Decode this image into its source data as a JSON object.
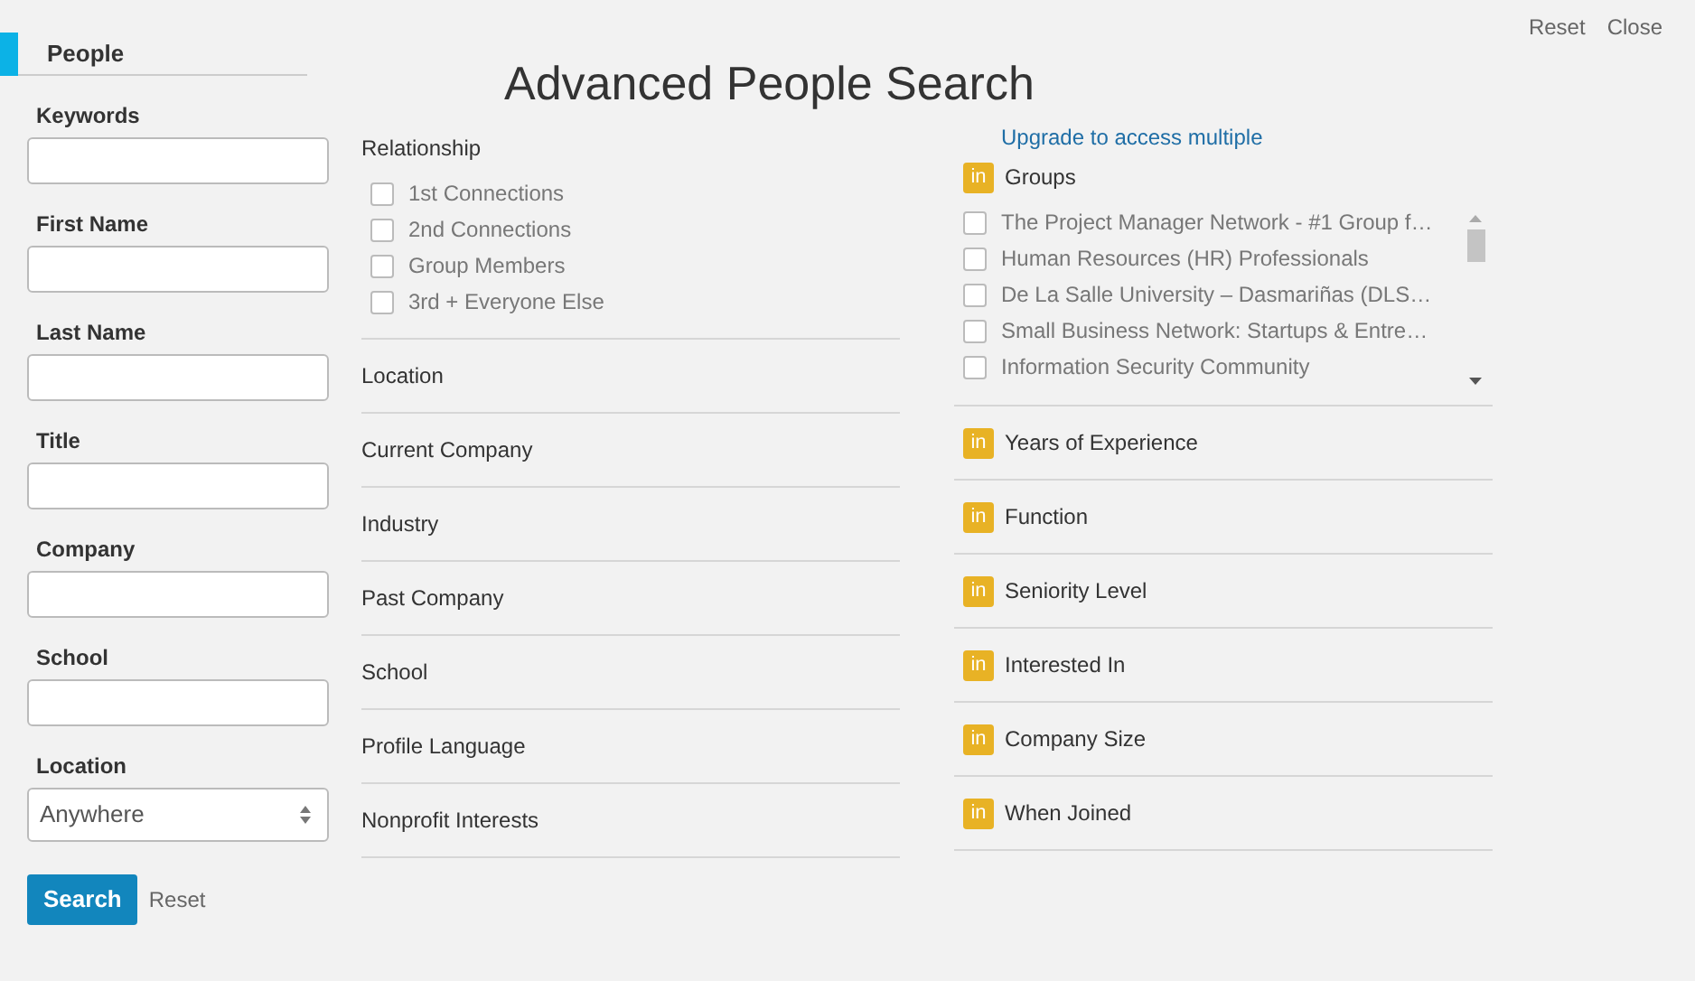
{
  "sidebar": {
    "tab": {
      "label": "People",
      "selected": true
    },
    "fields": [
      {
        "kind": "text",
        "label": "Keywords"
      },
      {
        "kind": "text",
        "label": "First Name"
      },
      {
        "kind": "text",
        "label": "Last Name"
      },
      {
        "kind": "text",
        "label": "Title"
      },
      {
        "kind": "text",
        "label": "Company"
      },
      {
        "kind": "text",
        "label": "School"
      },
      {
        "kind": "select",
        "label": "Location",
        "value": "Anywhere"
      }
    ],
    "search_button": "Search",
    "reset_link": "Reset"
  },
  "header": {
    "title": "Advanced People Search",
    "links": [
      "Reset",
      "Close"
    ]
  },
  "relationship": {
    "label": "Relationship",
    "options": [
      {
        "label": "1st Connections",
        "checked": false
      },
      {
        "label": "2nd Connections",
        "checked": false
      },
      {
        "label": "Group Members",
        "checked": false
      },
      {
        "label": "3rd + Everyone Else",
        "checked": false
      }
    ]
  },
  "filters": [
    "Location",
    "Current Company",
    "Industry",
    "Past Company",
    "School",
    "Profile Language",
    "Nonprofit Interests"
  ],
  "premium": {
    "upgrade_link": "Upgrade to access multiple",
    "groups_badge": "in",
    "groups_label": "Groups",
    "groups": [
      {
        "label": "The Project Manager Network - #1 Group f…",
        "checked": false
      },
      {
        "label": "Human Resources (HR) Professionals",
        "checked": false
      },
      {
        "label": "De La Salle University – Dasmariñas (DLS…",
        "checked": false
      },
      {
        "label": "Small Business Network: Startups & Entre…",
        "checked": false
      },
      {
        "label": "Information Security Community",
        "checked": false
      }
    ],
    "filters": [
      {
        "badge": "in",
        "label": "Years of Experience"
      },
      {
        "badge": "in",
        "label": "Function"
      },
      {
        "badge": "in",
        "label": "Seniority Level"
      },
      {
        "badge": "in",
        "label": "Interested In"
      },
      {
        "badge": "in",
        "label": "Company Size"
      },
      {
        "badge": "in",
        "label": "When Joined"
      }
    ]
  }
}
